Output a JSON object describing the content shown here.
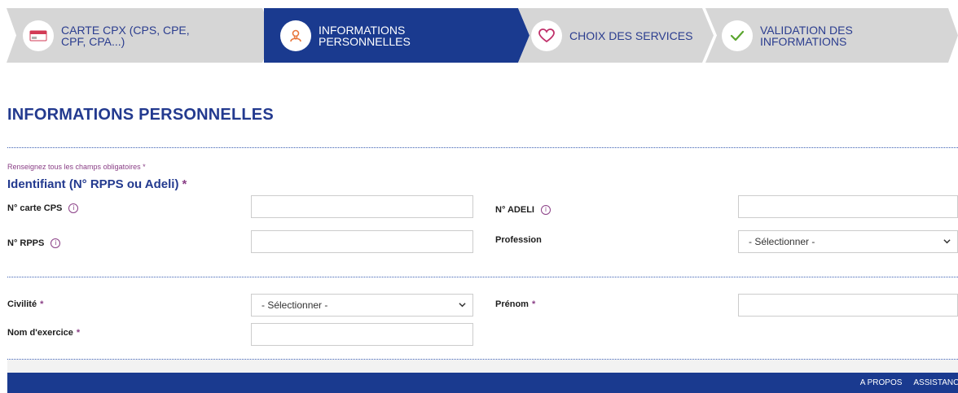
{
  "stepper": {
    "steps": [
      {
        "label": "CARTE CPX (CPS, CPE, CPF, CPA...)",
        "icon": "card-icon",
        "state": "done"
      },
      {
        "label": "INFORMATIONS PERSONNELLES",
        "icon": "person-icon",
        "state": "active"
      },
      {
        "label": "CHOIX DES SERVICES",
        "icon": "heart-icon",
        "state": "todo"
      },
      {
        "label": "VALIDATION DES INFORMATIONS",
        "icon": "checkmark-icon",
        "state": "todo"
      }
    ]
  },
  "page": {
    "title": "INFORMATIONS PERSONNELLES",
    "required_note": "Renseignez tous les champs obligatoires *",
    "identifier_section": "Identifiant (N° RPPS ou Adeli)",
    "required_star": "*"
  },
  "fields": {
    "cps": {
      "label": "N° carte CPS",
      "value": ""
    },
    "adeli": {
      "label": "N° ADELI",
      "value": ""
    },
    "rpps": {
      "label": "N° RPPS",
      "value": ""
    },
    "profession": {
      "label": "Profession",
      "value": "- Sélectionner -"
    },
    "civilite": {
      "label": "Civilité",
      "value": "- Sélectionner -"
    },
    "prenom": {
      "label": "Prénom",
      "value": ""
    },
    "nom": {
      "label": "Nom d'exercice",
      "value": ""
    }
  },
  "footer": {
    "links": [
      "A PROPOS",
      "ASSISTANCE"
    ]
  },
  "colors": {
    "primary_blue": "#1a3a8f",
    "step_gray": "#d6d6d6",
    "accent_purple": "#8a3f86",
    "accent_orange": "#e8753a",
    "accent_green": "#5aa52e",
    "accent_pink": "#c0306a"
  }
}
